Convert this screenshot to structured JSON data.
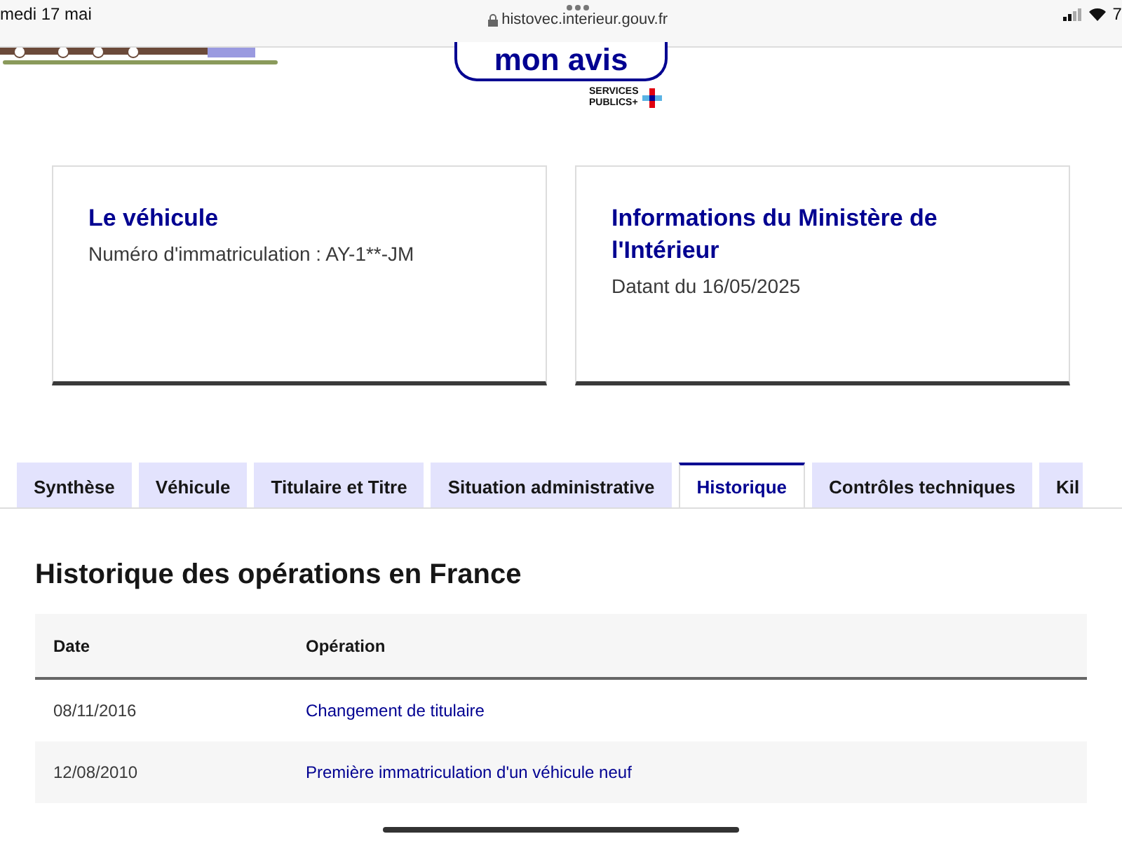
{
  "status_bar": {
    "date": "medi 17 mai",
    "url": "histovec.interieur.gouv.fr",
    "battery": "7"
  },
  "header": {
    "feedback_button": "mon avis",
    "logo_text": [
      "SERVICES",
      "PUBLICS+"
    ]
  },
  "cards": [
    {
      "title": "Le véhicule",
      "text": "Numéro d'immatriculation : AY-1**-JM"
    },
    {
      "title": "Informations du Ministère de l'Intérieur",
      "text": "Datant du 16/05/2025"
    }
  ],
  "tabs": [
    {
      "label": "Synthèse",
      "selected": false
    },
    {
      "label": "Véhicule",
      "selected": false
    },
    {
      "label": "Titulaire et Titre",
      "selected": false
    },
    {
      "label": "Situation administrative",
      "selected": false
    },
    {
      "label": "Historique",
      "selected": true
    },
    {
      "label": "Contrôles techniques",
      "selected": false
    },
    {
      "label": "Kil",
      "selected": false
    }
  ],
  "section": {
    "title": "Historique des opérations en France",
    "table": {
      "columns": [
        "Date",
        "Opération"
      ],
      "rows": [
        [
          "08/11/2016",
          "Changement de titulaire"
        ],
        [
          "12/08/2010",
          "Première immatriculation d'un véhicule neuf"
        ]
      ]
    }
  }
}
